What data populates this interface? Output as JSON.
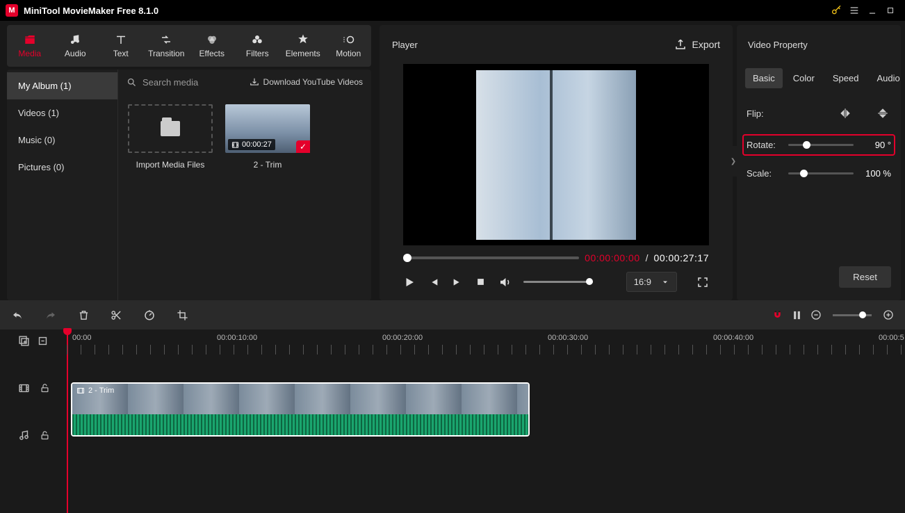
{
  "titlebar": {
    "title": "MiniTool MovieMaker Free 8.1.0"
  },
  "ribbon": {
    "tabs": [
      {
        "label": "Media"
      },
      {
        "label": "Audio"
      },
      {
        "label": "Text"
      },
      {
        "label": "Transition"
      },
      {
        "label": "Effects"
      },
      {
        "label": "Filters"
      },
      {
        "label": "Elements"
      },
      {
        "label": "Motion"
      }
    ],
    "activeTab": "Media"
  },
  "sidebar": {
    "items": [
      {
        "label": "My Album (1)"
      },
      {
        "label": "Videos (1)"
      },
      {
        "label": "Music (0)"
      },
      {
        "label": "Pictures (0)"
      }
    ]
  },
  "media": {
    "searchPlaceholder": "Search media",
    "downloadLink": "Download YouTube Videos",
    "importLabel": "Import Media Files",
    "clipName": "2 - Trim",
    "clipDuration": "00:00:27"
  },
  "player": {
    "title": "Player",
    "export": "Export",
    "currentTime": "00:00:00:00",
    "totalTime": "00:00:27:17",
    "sep": " / ",
    "aspect": "16:9"
  },
  "property": {
    "title": "Video Property",
    "tabs": [
      "Basic",
      "Color",
      "Speed",
      "Audio"
    ],
    "flipLabel": "Flip:",
    "rotateLabel": "Rotate:",
    "rotateValue": "90 °",
    "scaleLabel": "Scale:",
    "scaleValue": "100 %",
    "reset": "Reset"
  },
  "timeline": {
    "marks": [
      "00:00",
      "00:00:10:00",
      "00:00:20:00",
      "00:00:30:00",
      "00:00:40:00",
      "00:00:5"
    ],
    "clipTitle": "2 - Trim"
  }
}
